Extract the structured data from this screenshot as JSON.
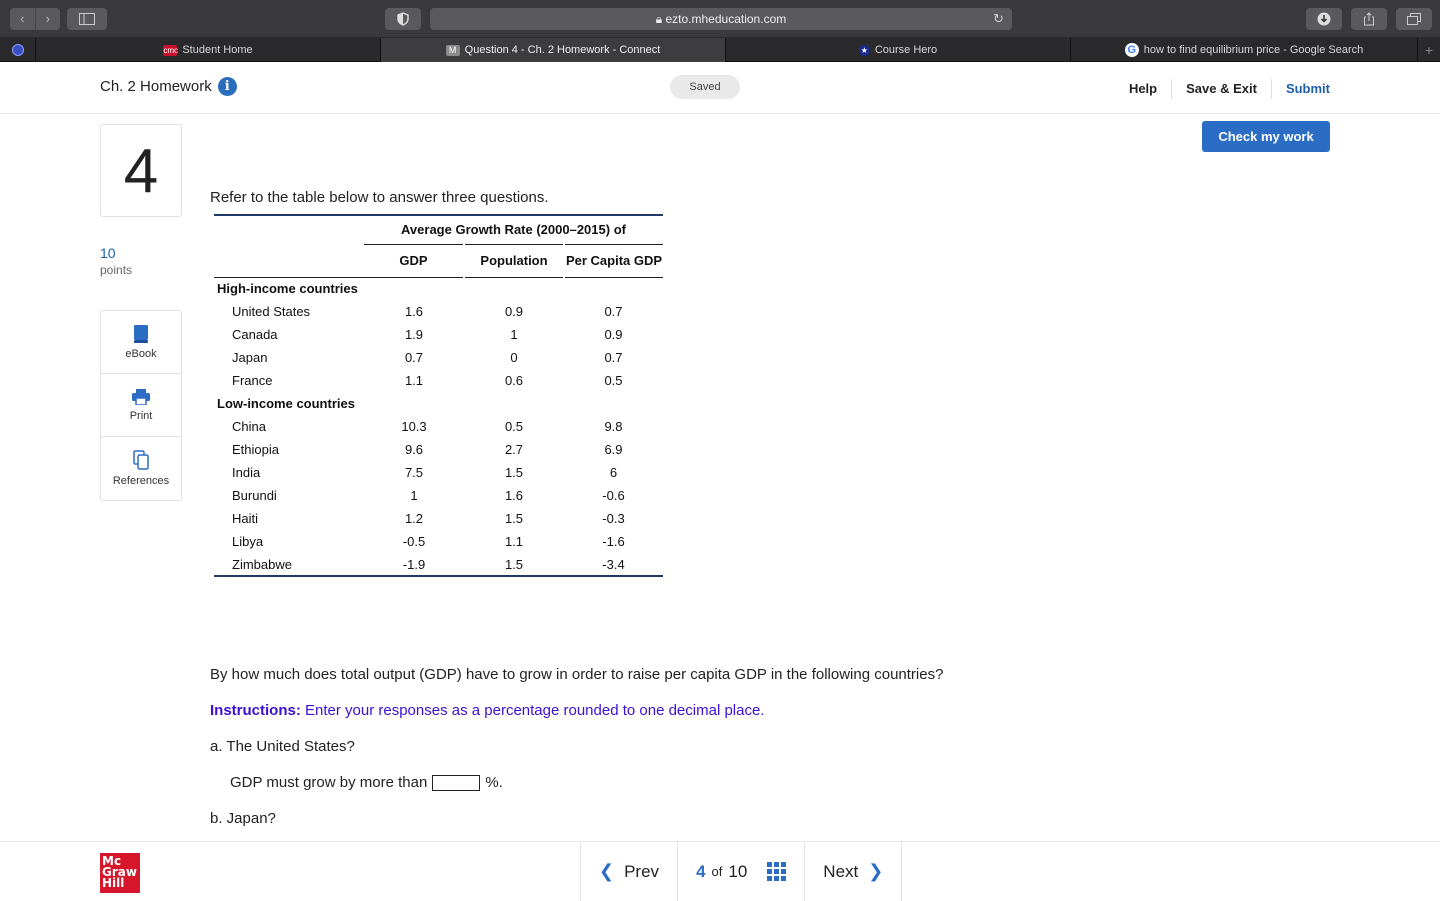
{
  "browser": {
    "url": "ezto.mheducation.com",
    "tabs": [
      {
        "label": "Student Home",
        "favicon": "cmc"
      },
      {
        "label": "Question 4 - Ch. 2 Homework - Connect",
        "favicon": "M"
      },
      {
        "label": "Course Hero",
        "favicon": "★"
      },
      {
        "label": "how to find equilibrium price - Google Search",
        "favicon": "G"
      }
    ]
  },
  "header": {
    "title": "Ch. 2 Homework",
    "saved": "Saved",
    "help": "Help",
    "save_exit": "Save & Exit",
    "submit": "Submit"
  },
  "question": {
    "number": "4",
    "points_value": "10",
    "points_label": "points",
    "check_button": "Check my work",
    "tools": {
      "ebook": "eBook",
      "print": "Print",
      "references": "References"
    },
    "prompt": "Refer to the table below to answer three questions.",
    "text": "By how much does total output (GDP) have to grow in order to raise per capita GDP in the following countries?",
    "instructions_label": "Instructions:",
    "instructions": "Enter your responses as a percentage rounded to one decimal place.",
    "part_a": "a. The United States?",
    "answer_prefix": "GDP must grow by more than",
    "answer_suffix": "%.",
    "answer_value": "",
    "part_b": "b. Japan?"
  },
  "table": {
    "span_header": "Average Growth Rate (2000–2015) of",
    "columns": [
      "GDP",
      "Population",
      "Per Capita GDP"
    ],
    "groups": [
      {
        "label": "High-income countries",
        "rows": [
          {
            "country": "United States",
            "gdp": "1.6",
            "population": "0.9",
            "per_capita": "0.7"
          },
          {
            "country": "Canada",
            "gdp": "1.9",
            "population": "1",
            "per_capita": "0.9"
          },
          {
            "country": "Japan",
            "gdp": "0.7",
            "population": "0",
            "per_capita": "0.7"
          },
          {
            "country": "France",
            "gdp": "1.1",
            "population": "0.6",
            "per_capita": "0.5"
          }
        ]
      },
      {
        "label": "Low-income countries",
        "rows": [
          {
            "country": "China",
            "gdp": "10.3",
            "population": "0.5",
            "per_capita": "9.8"
          },
          {
            "country": "Ethiopia",
            "gdp": "9.6",
            "population": "2.7",
            "per_capita": "6.9"
          },
          {
            "country": "India",
            "gdp": "7.5",
            "population": "1.5",
            "per_capita": "6"
          },
          {
            "country": "Burundi",
            "gdp": "1",
            "population": "1.6",
            "per_capita": "-0.6"
          },
          {
            "country": "Haiti",
            "gdp": "1.2",
            "population": "1.5",
            "per_capita": "-0.3"
          },
          {
            "country": "Libya",
            "gdp": "-0.5",
            "population": "1.1",
            "per_capita": "-1.6"
          },
          {
            "country": "Zimbabwe",
            "gdp": "-1.9",
            "population": "1.5",
            "per_capita": "-3.4"
          }
        ]
      }
    ]
  },
  "footer": {
    "logo_lines": [
      "Mc",
      "Graw",
      "Hill"
    ],
    "prev": "Prev",
    "current_page": "4",
    "of_label": "of",
    "total_pages": "10",
    "next": "Next"
  },
  "colors": {
    "accent": "#2b6cc4",
    "instructions": "#3b10d4",
    "logo": "#d6162b"
  },
  "icons": [
    "info-icon",
    "ebook-icon",
    "print-icon",
    "references-icon",
    "grid-icon",
    "chevron-left-icon",
    "chevron-right-icon",
    "lock-icon",
    "reload-icon"
  ]
}
